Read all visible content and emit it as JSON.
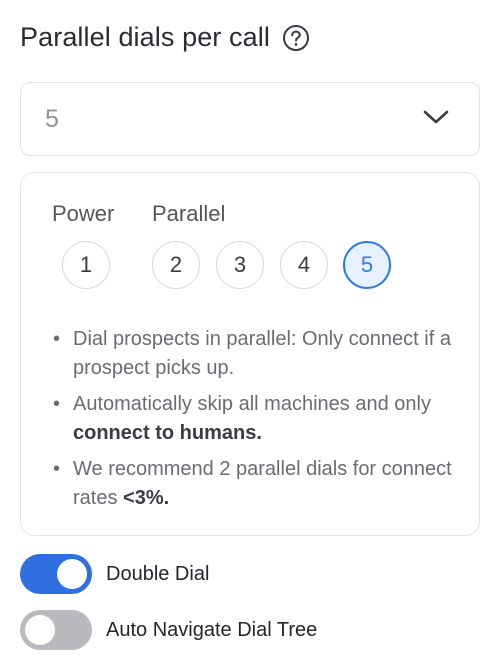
{
  "header": {
    "title": "Parallel dials per call",
    "help_icon": "question-circle-icon"
  },
  "select": {
    "value": "5",
    "chevron_icon": "chevron-down-icon"
  },
  "panel": {
    "power_label": "Power",
    "parallel_label": "Parallel",
    "options": [
      "1",
      "2",
      "3",
      "4",
      "5"
    ],
    "selected": "5",
    "accent_color": "#2f7de1",
    "bullets": [
      {
        "text": "Dial prospects in parallel: Only connect if a prospect picks up.",
        "bold": ""
      },
      {
        "text": "Automatically skip all machines and only ",
        "bold": "connect to humans."
      },
      {
        "text": "We recommend 2 parallel dials for connect rates ",
        "bold": "<3%."
      }
    ]
  },
  "toggles": [
    {
      "label": "Double Dial",
      "on": true
    },
    {
      "label": "Auto Navigate Dial Tree",
      "on": false
    }
  ],
  "colors": {
    "toggle_on": "#2f6fe0",
    "toggle_off": "#b9babe"
  }
}
